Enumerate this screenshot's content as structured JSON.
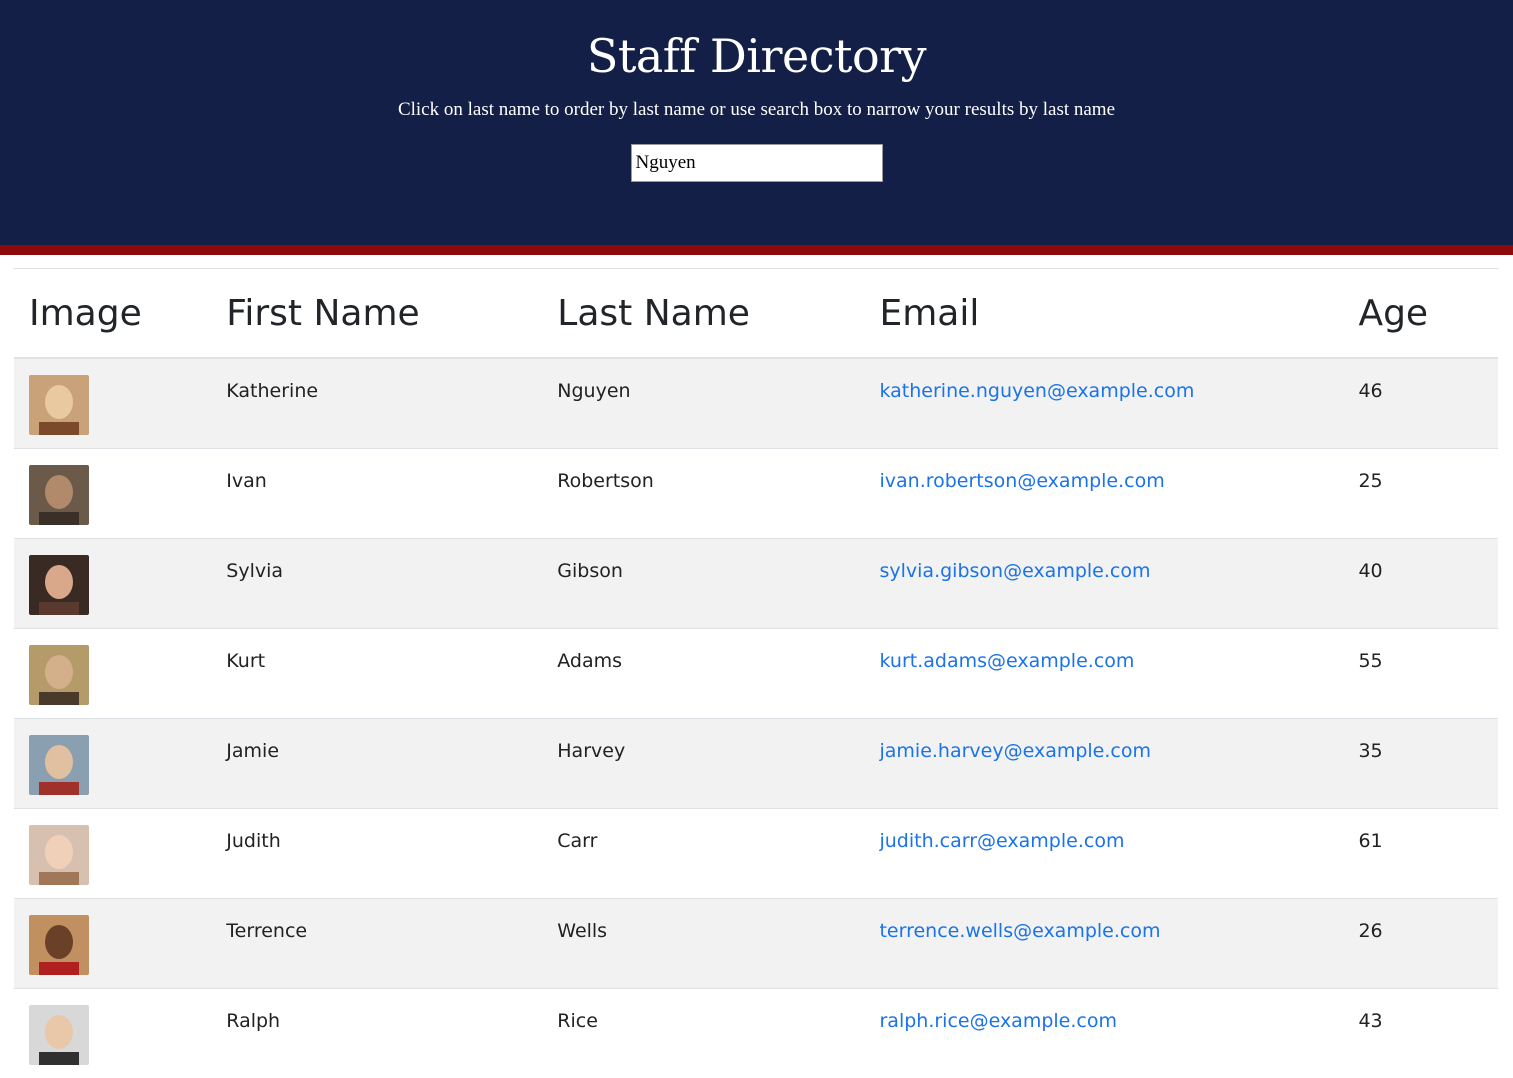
{
  "header": {
    "title": "Staff Directory",
    "subtitle": "Click on last name to order by last name or use search box to narrow your results by last name"
  },
  "search": {
    "value": "Nguyen",
    "placeholder": ""
  },
  "colors": {
    "header_bg": "#131f47",
    "accent_bar": "#8c0a0a",
    "link": "#1a73e8",
    "stripe": "#f2f2f2"
  },
  "table": {
    "columns": [
      "Image",
      "First Name",
      "Last Name",
      "Email",
      "Age"
    ],
    "rows": [
      {
        "first": "Katherine",
        "last": "Nguyen",
        "email": "katherine.nguyen@example.com",
        "age": "46",
        "avatar": "avatar-photo"
      },
      {
        "first": "Ivan",
        "last": "Robertson",
        "email": "ivan.robertson@example.com",
        "age": "25",
        "avatar": "avatar-photo"
      },
      {
        "first": "Sylvia",
        "last": "Gibson",
        "email": "sylvia.gibson@example.com",
        "age": "40",
        "avatar": "avatar-photo"
      },
      {
        "first": "Kurt",
        "last": "Adams",
        "email": "kurt.adams@example.com",
        "age": "55",
        "avatar": "avatar-photo"
      },
      {
        "first": "Jamie",
        "last": "Harvey",
        "email": "jamie.harvey@example.com",
        "age": "35",
        "avatar": "avatar-photo"
      },
      {
        "first": "Judith",
        "last": "Carr",
        "email": "judith.carr@example.com",
        "age": "61",
        "avatar": "avatar-photo"
      },
      {
        "first": "Terrence",
        "last": "Wells",
        "email": "terrence.wells@example.com",
        "age": "26",
        "avatar": "avatar-photo"
      },
      {
        "first": "Ralph",
        "last": "Rice",
        "email": "ralph.rice@example.com",
        "age": "43",
        "avatar": "avatar-photo"
      }
    ]
  }
}
